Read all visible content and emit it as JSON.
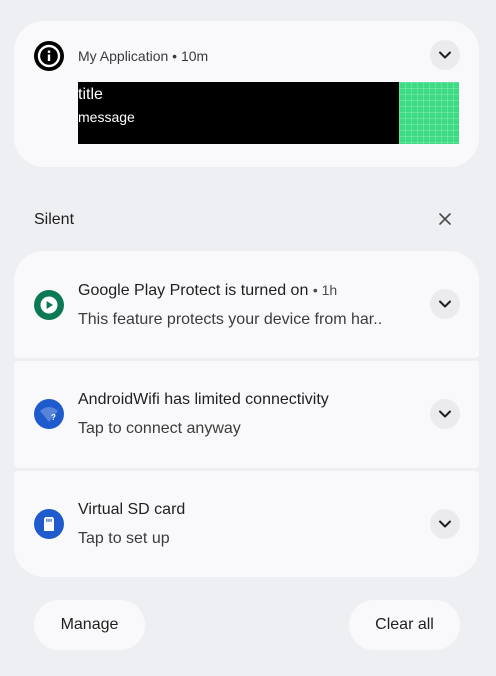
{
  "app_notification": {
    "app_name": "My Application",
    "separator": "•",
    "time": "10m",
    "icon": "info-icon",
    "media_title": "title",
    "media_message": "message",
    "accent_color": "#3ddc84"
  },
  "silent_section": {
    "title": "Silent",
    "close_icon": "close-icon"
  },
  "notifications": [
    {
      "title": "Google Play Protect is turned on",
      "time": "1h",
      "text": "This feature protects your device from har..",
      "icon": "play-protect-icon",
      "icon_color": "#0b7a54"
    },
    {
      "title": "AndroidWifi has limited connectivity",
      "text": "Tap to connect anyway",
      "icon": "wifi-warning-icon",
      "icon_color": "#1f5bcc"
    },
    {
      "title": "Virtual SD card",
      "text": "Tap to set up",
      "icon": "sd-card-icon",
      "icon_color": "#1f5bcc"
    }
  ],
  "footer": {
    "manage_label": "Manage",
    "clear_all_label": "Clear all"
  }
}
